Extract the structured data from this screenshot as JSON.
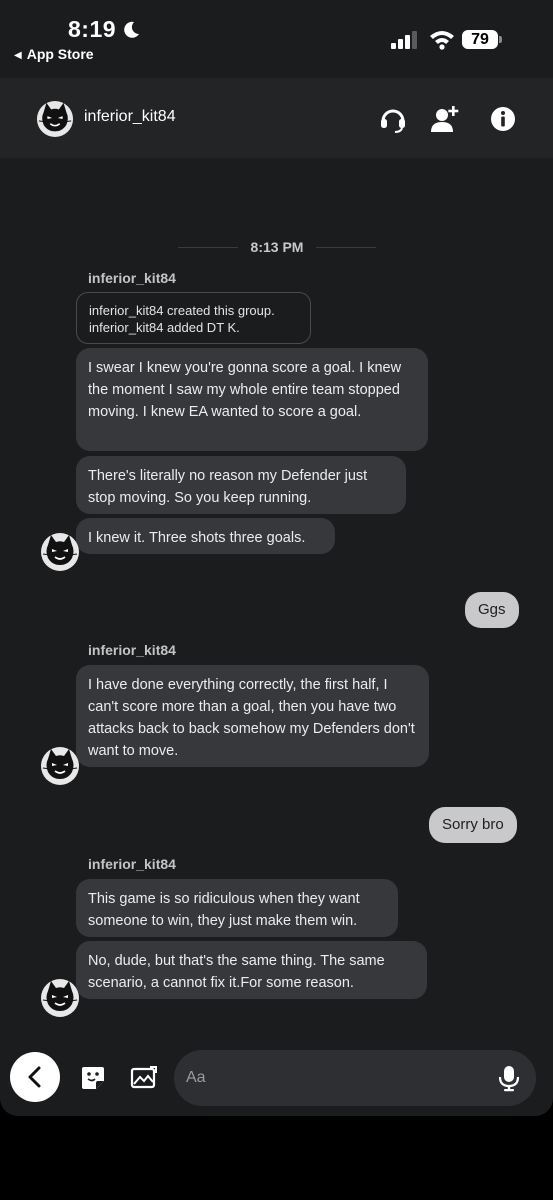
{
  "status_bar": {
    "time": "8:19",
    "back_app": "App Store",
    "battery": "79"
  },
  "header": {
    "username": "inferior_kit84",
    "icons": [
      "headset-icon",
      "add-user-icon",
      "info-icon"
    ]
  },
  "chat": {
    "time_divider": "8:13 PM",
    "system_note": {
      "line1": "inferior_kit84 created this group.",
      "line2": "inferior_kit84 added DT K."
    },
    "groups": [
      {
        "sender": "inferior_kit84",
        "messages": [
          "I swear I knew you're gonna score a goal. I knew the moment I saw my whole entire team stopped moving. I knew EA wanted to score a goal.",
          "There's literally no reason my Defender just stop moving. So you keep running.",
          "I knew it. Three shots three goals."
        ]
      },
      {
        "outgoing": "Ggs"
      },
      {
        "sender": "inferior_kit84",
        "messages": [
          "I have done everything correctly, the first half, I can't score more than a goal, then you have two attacks back to back somehow my Defenders don't want to move."
        ]
      },
      {
        "outgoing": "Sorry bro"
      },
      {
        "sender": "inferior_kit84",
        "messages": [
          "This game is so ridiculous when they want someone to win, they just make them win.",
          "No, dude, but that's the same thing. The same scenario, a cannot fix it.For some reason."
        ]
      }
    ]
  },
  "composer": {
    "placeholder": "Aa",
    "value": ""
  },
  "colors": {
    "background": "#1b1c1e",
    "incoming_bubble": "#37383b",
    "outgoing_bubble": "#c9c9cb"
  }
}
